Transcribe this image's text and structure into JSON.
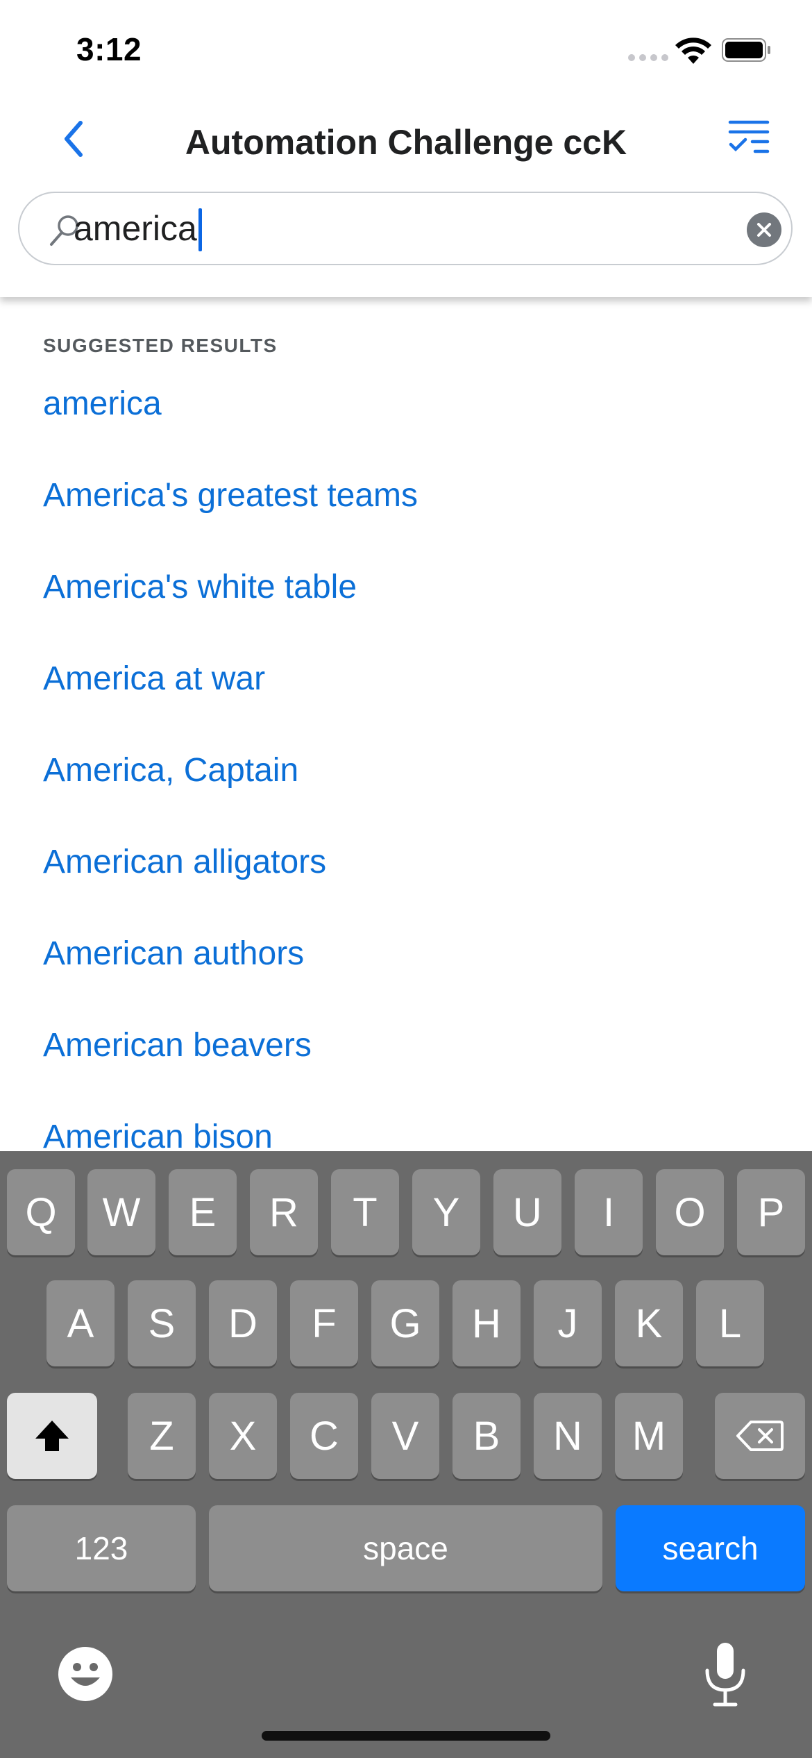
{
  "status_bar": {
    "time": "3:12"
  },
  "header": {
    "title": "Automation Challenge ccK"
  },
  "search": {
    "value": "america",
    "placeholder": ""
  },
  "results": {
    "section_label": "SUGGESTED RESULTS",
    "items": [
      "america",
      "America's greatest teams",
      "America's white table",
      "America at war",
      "America, Captain",
      "American alligators",
      "American authors",
      "American beavers",
      "American bison"
    ]
  },
  "keyboard": {
    "row1": [
      "Q",
      "W",
      "E",
      "R",
      "T",
      "Y",
      "U",
      "I",
      "O",
      "P"
    ],
    "row2": [
      "A",
      "S",
      "D",
      "F",
      "G",
      "H",
      "J",
      "K",
      "L"
    ],
    "row3": [
      "Z",
      "X",
      "C",
      "V",
      "B",
      "N",
      "M"
    ],
    "numbers_label": "123",
    "space_label": "space",
    "search_label": "search"
  },
  "colors": {
    "accent": "#0b6fd7",
    "search_key": "#0a7aff",
    "keyboard_bg": "#6a6a6a",
    "key_bg": "#8e8e8e"
  },
  "icons": [
    "back-chevron-icon",
    "filter-list-icon",
    "search-icon",
    "clear-icon",
    "shift-icon",
    "backspace-icon",
    "emoji-icon",
    "microphone-icon",
    "wifi-icon",
    "battery-icon"
  ]
}
